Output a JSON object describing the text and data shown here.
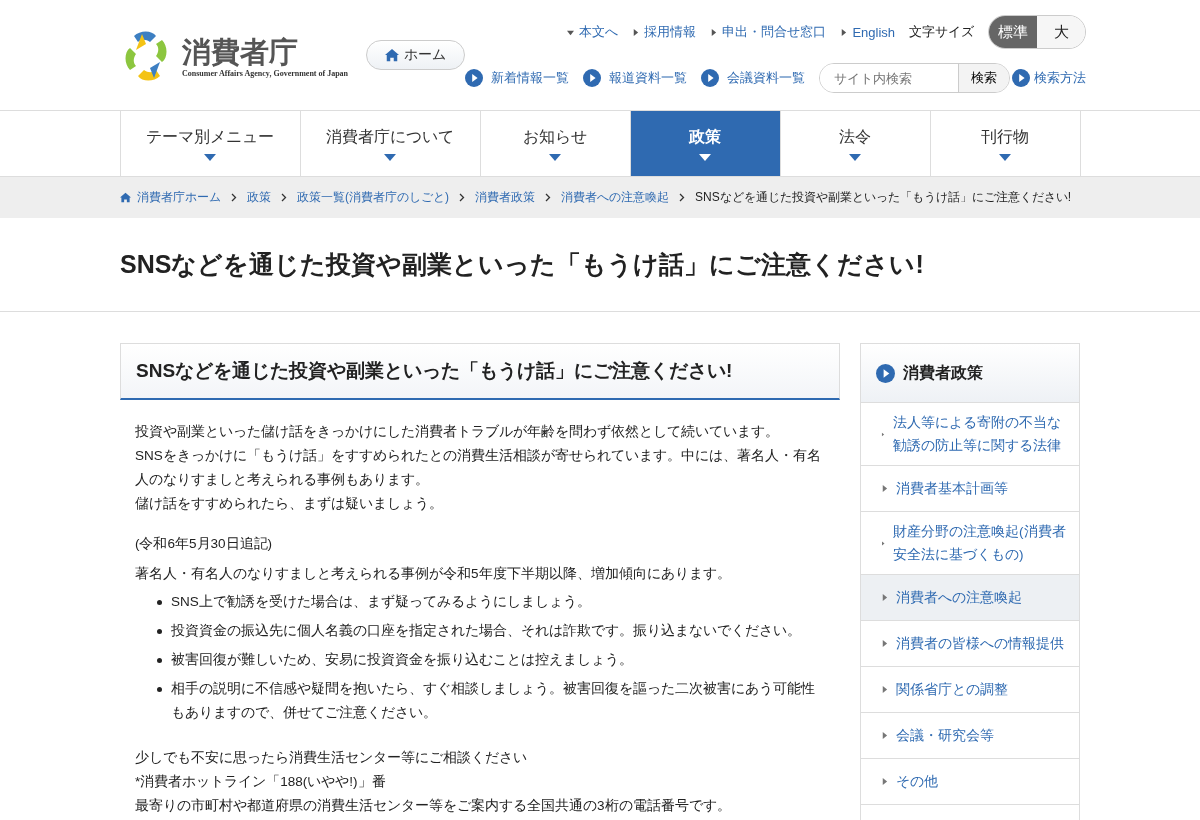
{
  "header": {
    "logo": {
      "name": "消費者庁",
      "subtitle": "Consumer Affairs Agency, Government of Japan"
    },
    "home_button": "ホーム",
    "top_links": [
      {
        "label": "本文へ",
        "kind": "down"
      },
      {
        "label": "採用情報",
        "kind": "right"
      },
      {
        "label": "申出・問合せ窓口",
        "kind": "right"
      },
      {
        "label": "English",
        "kind": "right"
      }
    ],
    "font_size": {
      "label": "文字サイズ",
      "options": [
        {
          "label": "標準",
          "selected": true
        },
        {
          "label": "大",
          "selected": false
        }
      ]
    },
    "quick_links": [
      "新着情報一覧",
      "報道資料一覧",
      "会議資料一覧"
    ],
    "search": {
      "placeholder": "サイト内検索",
      "button": "検索",
      "help": "検索方法"
    }
  },
  "nav": [
    {
      "label": "テーマ別メニュー",
      "selected": false
    },
    {
      "label": "消費者庁について",
      "selected": false
    },
    {
      "label": "お知らせ",
      "selected": false
    },
    {
      "label": "政策",
      "selected": true
    },
    {
      "label": "法令",
      "selected": false
    },
    {
      "label": "刊行物",
      "selected": false
    }
  ],
  "breadcrumb": [
    "消費者庁ホーム",
    "政策",
    "政策一覧(消費者庁のしごと)",
    "消費者政策",
    "消費者への注意喚起",
    "SNSなどを通じた投資や副業といった「もうけ話」にご注意ください!"
  ],
  "page_title": "SNSなどを通じた投資や副業といった「もうけ話」にご注意ください!",
  "article": {
    "heading": "SNSなどを通じた投資や副業といった「もうけ話」にご注意ください!",
    "intro": [
      "投資や副業といった儲け話をきっかけにした消費者トラブルが年齢を問わず依然として続いています。",
      "SNSをきっかけに「もうけ話」をすすめられたとの消費生活相談が寄せられています。中には、著名人・有名人のなりすましと考えられる事例もあります。",
      "儲け話をすすめられたら、まずは疑いましょう。"
    ],
    "note_date": "(令和6年5月30日追記)",
    "note_text": "著名人・有名人のなりすましと考えられる事例が令和5年度下半期以降、増加傾向にあります。",
    "bullets": [
      "SNS上で勧誘を受けた場合は、まず疑ってみるようにしましょう。",
      "投資資金の振込先に個人名義の口座を指定された場合、それは詐欺です。振り込まないでください。",
      "被害回復が難しいため、安易に投資資金を振り込むことは控えましょう。",
      "相手の説明に不信感や疑問を抱いたら、すぐ相談しましょう。被害回復を謳った二次被害にあう可能性もありますので、併せてご注意ください。"
    ],
    "closing": [
      "少しでも不安に思ったら消費生活センター等にご相談ください",
      "*消費者ホットライン「188(いやや!)」番",
      "最寄りの市町村や都道府県の消費生活センター等をご案内する全国共通の3桁の電話番号です。"
    ]
  },
  "sidebar": {
    "title": "消費者政策",
    "items": [
      {
        "label": "法人等による寄附の不当な勧誘の防止等に関する法律",
        "selected": false
      },
      {
        "label": "消費者基本計画等",
        "selected": false
      },
      {
        "label": "財産分野の注意喚起(消費者安全法に基づくもの)",
        "selected": false
      },
      {
        "label": "消費者への注意喚起",
        "selected": true
      },
      {
        "label": "消費者の皆様への情報提供",
        "selected": false
      },
      {
        "label": "関係省庁との調整",
        "selected": false
      },
      {
        "label": "会議・研究会等",
        "selected": false
      },
      {
        "label": "その他",
        "selected": false
      }
    ]
  }
}
